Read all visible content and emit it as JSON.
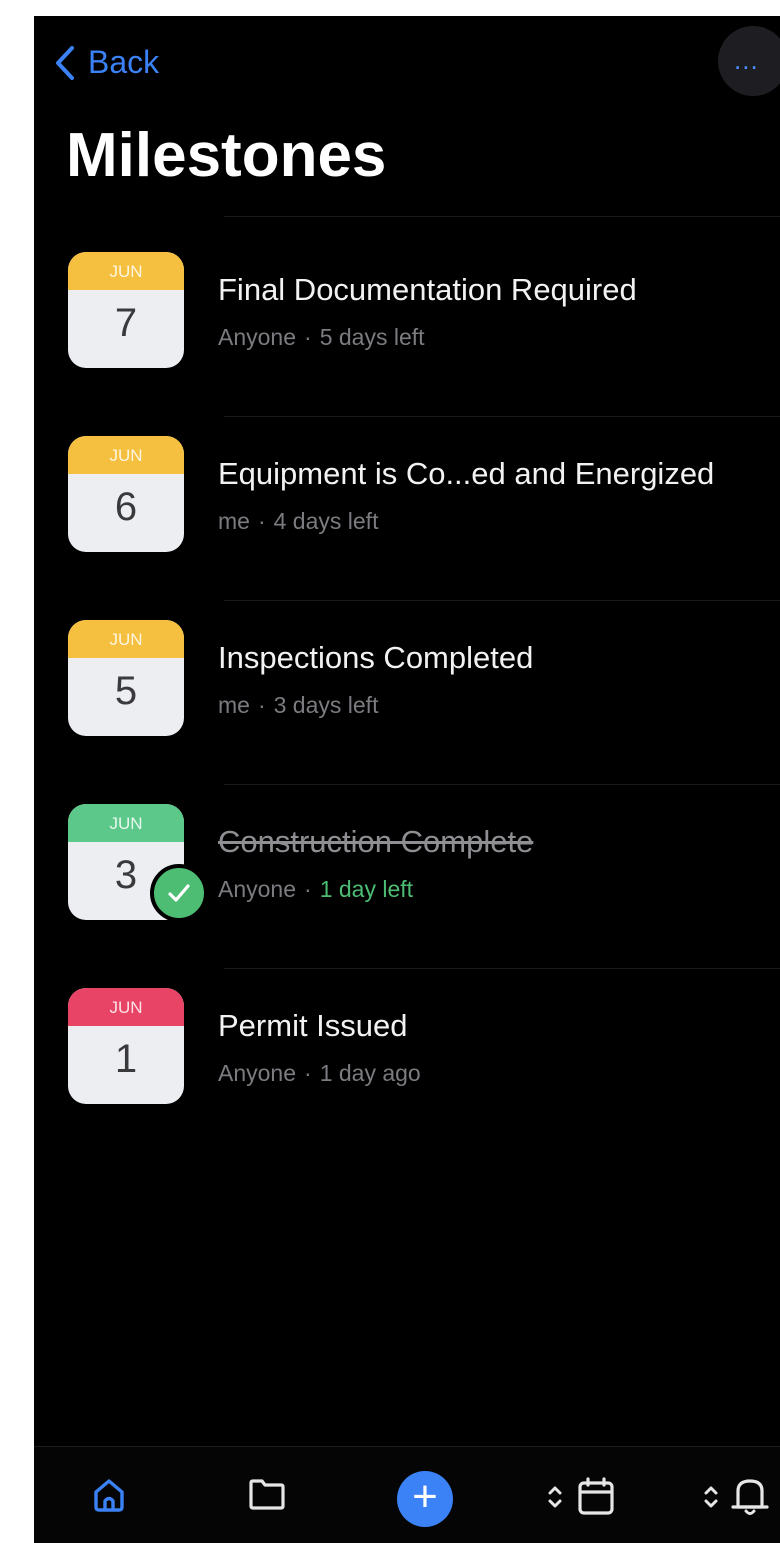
{
  "nav": {
    "back_label": "Back",
    "more_label": "..."
  },
  "page": {
    "title": "Milestones"
  },
  "milestones": [
    {
      "month": "JUN",
      "day": "7",
      "title": "Final Documentation Required",
      "assignee": "Anyone",
      "separator": "·",
      "due": "5 days left",
      "color": "#f5bf3f",
      "completed": false
    },
    {
      "month": "JUN",
      "day": "6",
      "title": "Equipment is Co...ed and Energized",
      "assignee": "me",
      "separator": "·",
      "due": "4 days left",
      "color": "#f5bf3f",
      "completed": false
    },
    {
      "month": "JUN",
      "day": "5",
      "title": "Inspections Completed",
      "assignee": "me",
      "separator": "·",
      "due": "3 days left",
      "color": "#f5bf3f",
      "completed": false
    },
    {
      "month": "JUN",
      "day": "3",
      "title": "Construction Complete",
      "assignee": "Anyone",
      "separator": "·",
      "due": "1 day left",
      "color": "#5cc98a",
      "completed": true
    },
    {
      "month": "JUN",
      "day": "1",
      "title": "Permit Issued",
      "assignee": "Anyone",
      "separator": "·",
      "due": "1 day ago",
      "color": "#e84466",
      "completed": false
    }
  ],
  "tabbar": {
    "items": [
      "home-icon",
      "folder-icon",
      "add-icon",
      "calendar-icon",
      "bell-icon"
    ],
    "add_label": "+",
    "active": "home",
    "accent": "#3b82f6",
    "due_completed_color": "#4dbd74"
  }
}
